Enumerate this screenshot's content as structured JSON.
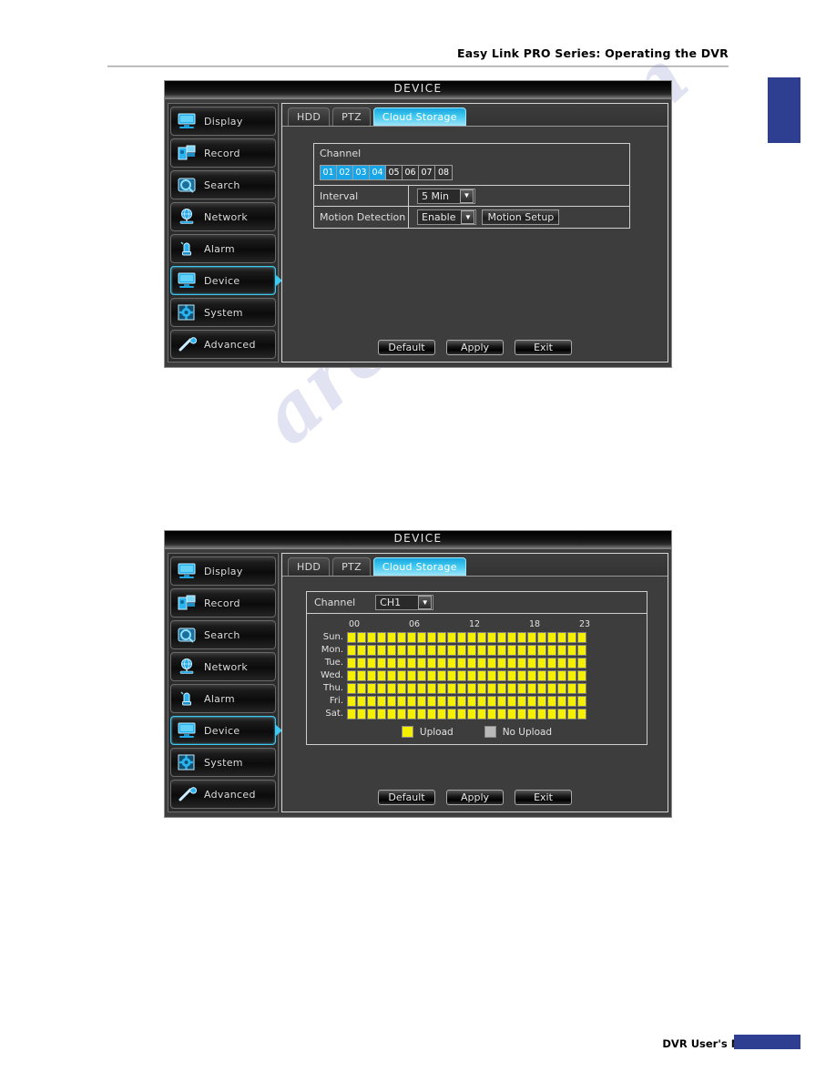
{
  "page": {
    "header_text": "Easy Link PRO Series: Operating the DVR",
    "footer_text": "DVR User's Manual",
    "watermark_text": "archive.com"
  },
  "sidebar": {
    "items": [
      {
        "label": "Display",
        "icon": "monitor-icon",
        "active": false
      },
      {
        "label": "Record",
        "icon": "camera-icon",
        "active": false
      },
      {
        "label": "Search",
        "icon": "hdd-search-icon",
        "active": false
      },
      {
        "label": "Network",
        "icon": "globe-icon",
        "active": false
      },
      {
        "label": "Alarm",
        "icon": "siren-icon",
        "active": false
      },
      {
        "label": "Device",
        "icon": "monitor-icon",
        "active": true
      },
      {
        "label": "System",
        "icon": "gear-icon",
        "active": false
      },
      {
        "label": "Advanced",
        "icon": "wrench-icon",
        "active": false
      }
    ]
  },
  "colors": {
    "accent": "#3fc8f0",
    "channel_on": "#18a6e8",
    "upload": "#f5f000",
    "no_upload": "#b9b9b9",
    "panel_bg": "#3d3d3d",
    "brand_blue": "#2e3f91"
  },
  "panel_top": {
    "window_title": "DEVICE",
    "tabs": [
      {
        "label": "HDD",
        "active": false
      },
      {
        "label": "PTZ",
        "active": false
      },
      {
        "label": "Cloud Storage",
        "active": true
      }
    ],
    "channel": {
      "label": "Channel",
      "cells": [
        {
          "id": "01",
          "selected": true
        },
        {
          "id": "02",
          "selected": true
        },
        {
          "id": "03",
          "selected": true
        },
        {
          "id": "04",
          "selected": true
        },
        {
          "id": "05",
          "selected": false
        },
        {
          "id": "06",
          "selected": false
        },
        {
          "id": "07",
          "selected": false
        },
        {
          "id": "08",
          "selected": false
        }
      ]
    },
    "rows": [
      {
        "key": "Interval",
        "value": "5 Min",
        "has_select": true,
        "button": null
      },
      {
        "key": "Motion Detection",
        "value": "Enable",
        "has_select": true,
        "button": "Motion Setup"
      }
    ],
    "buttons": [
      {
        "label": "Default"
      },
      {
        "label": "Apply"
      },
      {
        "label": "Exit"
      }
    ]
  },
  "panel_bottom": {
    "window_title": "DEVICE",
    "tabs": [
      {
        "label": "HDD",
        "active": false
      },
      {
        "label": "PTZ",
        "active": false
      },
      {
        "label": "Cloud Storage",
        "active": true
      }
    ],
    "channel_select": {
      "label": "Channel",
      "value": "CH1"
    },
    "schedule": {
      "hour_ticks": [
        "00",
        "06",
        "12",
        "18",
        "23"
      ],
      "hour_tick_positions": [
        0,
        6,
        12,
        18,
        23
      ],
      "days": [
        "Sun.",
        "Mon.",
        "Tue.",
        "Wed.",
        "Thu.",
        "Fri.",
        "Sat."
      ],
      "hours_per_day": 24,
      "cells": [
        [
          1,
          1,
          1,
          1,
          1,
          1,
          1,
          1,
          1,
          1,
          1,
          1,
          1,
          1,
          1,
          1,
          1,
          1,
          1,
          1,
          1,
          1,
          1,
          1
        ],
        [
          1,
          1,
          1,
          1,
          1,
          1,
          1,
          1,
          1,
          1,
          1,
          1,
          1,
          1,
          1,
          1,
          1,
          1,
          1,
          1,
          1,
          1,
          1,
          1
        ],
        [
          1,
          1,
          1,
          1,
          1,
          1,
          1,
          1,
          1,
          1,
          1,
          1,
          1,
          1,
          1,
          1,
          1,
          1,
          1,
          1,
          1,
          1,
          1,
          1
        ],
        [
          1,
          1,
          1,
          1,
          1,
          1,
          1,
          1,
          1,
          1,
          1,
          1,
          1,
          1,
          1,
          1,
          1,
          1,
          1,
          1,
          1,
          1,
          1,
          1
        ],
        [
          1,
          1,
          1,
          1,
          1,
          1,
          1,
          1,
          1,
          1,
          1,
          1,
          1,
          1,
          1,
          1,
          1,
          1,
          1,
          1,
          1,
          1,
          1,
          1
        ],
        [
          1,
          1,
          1,
          1,
          1,
          1,
          1,
          1,
          1,
          1,
          1,
          1,
          1,
          1,
          1,
          1,
          1,
          1,
          1,
          1,
          1,
          1,
          1,
          1
        ],
        [
          1,
          1,
          1,
          1,
          1,
          1,
          1,
          1,
          1,
          1,
          1,
          1,
          1,
          1,
          1,
          1,
          1,
          1,
          1,
          1,
          1,
          1,
          1,
          1
        ]
      ]
    },
    "legend": [
      {
        "label": "Upload",
        "state": "upload"
      },
      {
        "label": "No Upload",
        "state": "no_upload"
      }
    ],
    "buttons": [
      {
        "label": "Default"
      },
      {
        "label": "Apply"
      },
      {
        "label": "Exit"
      }
    ]
  }
}
